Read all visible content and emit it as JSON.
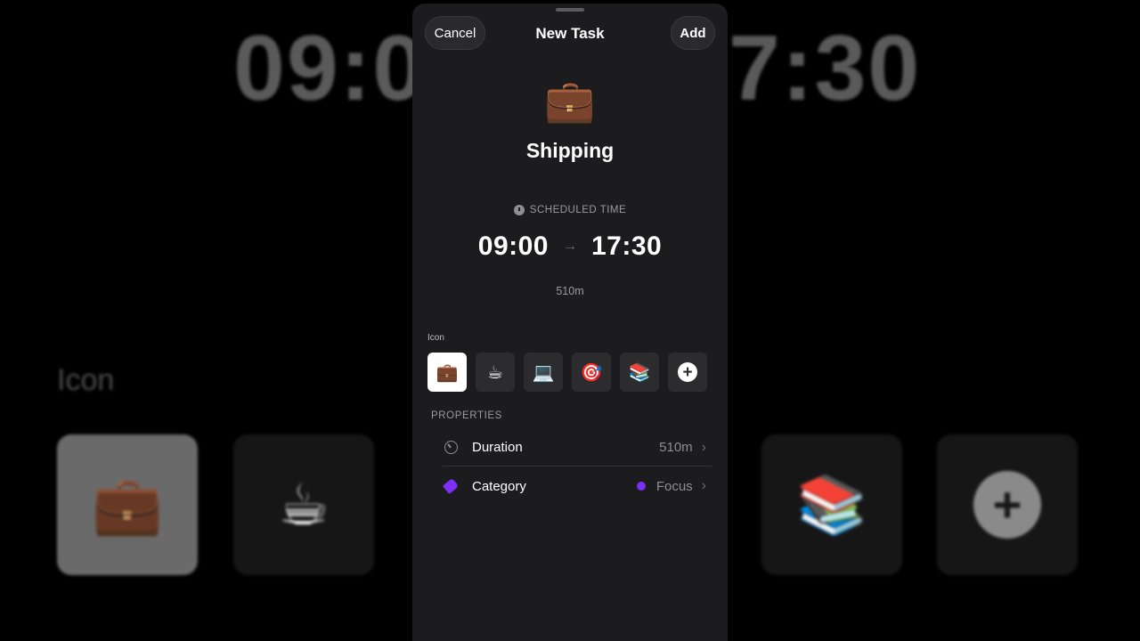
{
  "background": {
    "start_time": "09:0",
    "end_time": "7:30",
    "icon_label": "Icon",
    "tiles": [
      "💼",
      "☕",
      "",
      "",
      "📚",
      "+"
    ]
  },
  "header": {
    "cancel_label": "Cancel",
    "title": "New Task",
    "add_label": "Add"
  },
  "task": {
    "emoji": "💼",
    "name": "Shipping"
  },
  "schedule": {
    "label": "SCHEDULED TIME",
    "start": "09:00",
    "arrow": "→",
    "end": "17:30",
    "duration": "510m"
  },
  "icons": {
    "label": "Icon",
    "options": [
      {
        "glyph": "💼",
        "name": "briefcase-icon",
        "selected": true
      },
      {
        "glyph": "☕",
        "name": "coffee-icon",
        "selected": false
      },
      {
        "glyph": "💻",
        "name": "laptop-icon",
        "selected": false
      },
      {
        "glyph": "🎯",
        "name": "target-icon",
        "selected": false
      },
      {
        "glyph": "📚",
        "name": "books-icon",
        "selected": false
      }
    ],
    "add_glyph": "+"
  },
  "properties": {
    "label": "PROPERTIES",
    "duration": {
      "label": "Duration",
      "value": "510m",
      "icon": "timer-icon"
    },
    "category": {
      "label": "Category",
      "value": "Focus",
      "icon": "tag-icon",
      "color": "#7b2ff7"
    }
  },
  "colors": {
    "sheet": "#1c1c1e",
    "accent": "#7b2ff7",
    "tile": "#2c2c2e"
  }
}
